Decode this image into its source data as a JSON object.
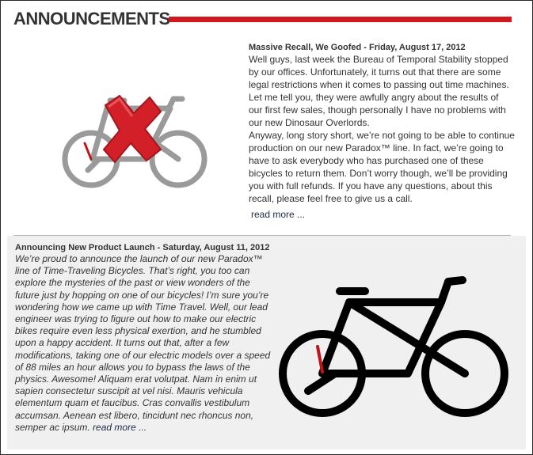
{
  "header": {
    "title": "ANNOUNCEMENTS"
  },
  "colors": {
    "accent": "#d0191f",
    "text": "#333333",
    "link": "#1b2a44"
  },
  "posts": [
    {
      "title": "Massive Recall, We Goofed - Friday, August 17, 2012",
      "paragraphs": [
        "Well guys, last week the Bureau of Temporal Stability stopped by our offices. Unfortunately, it turns out that there are some legal restrictions when it comes to passing out time machines. Let me tell you, they were awfully angry about the results of our first few sales, though personally I have no problems with our new Dinosaur Overlords.",
        "Anyway, long story short, we’re not going to be able to continue production on our new Paradox™ line. In fact, we’re going to have to ask everybody who has purchased one of these bicycles to return them. Don’t worry though, we’ll be providing you with full refunds. If you have any questions, about this recall, please feel free to give us a call."
      ],
      "read_more": "read more ...",
      "image_icon": "bicycle-recall-x-icon"
    },
    {
      "title": "Announcing New Product Launch - Saturday, August 11, 2012",
      "body": "We’re proud to announce the launch of our new Paradox™ line of Time-Traveling Bicycles. That’s right, you too can explore the mysteries of the past or view wonders of the future just by hopping on one of our bicycles! I’m sure you’re wondering how we came up with Time Travel. Well, our lead engineer was trying to figure out how to make our electric bikes require even less physical exertion, and he stumbled upon a happy accident. It turns out that, after a few modifications, taking one of our electric models over a speed of 88 miles an hour allows you to bypass the laws of the physics. Awesome! Aliquam erat volutpat. Nam in enim ut sapien consectetur suscipit at vel nisi. Mauris vehicula elementum quam et faucibus. Cras convallis vestibulum accumsan. Aenean est libero, tincidunt nec rhoncus non, semper ac ipsum.",
      "read_more": "read more ...",
      "image_icon": "bicycle-icon"
    }
  ]
}
